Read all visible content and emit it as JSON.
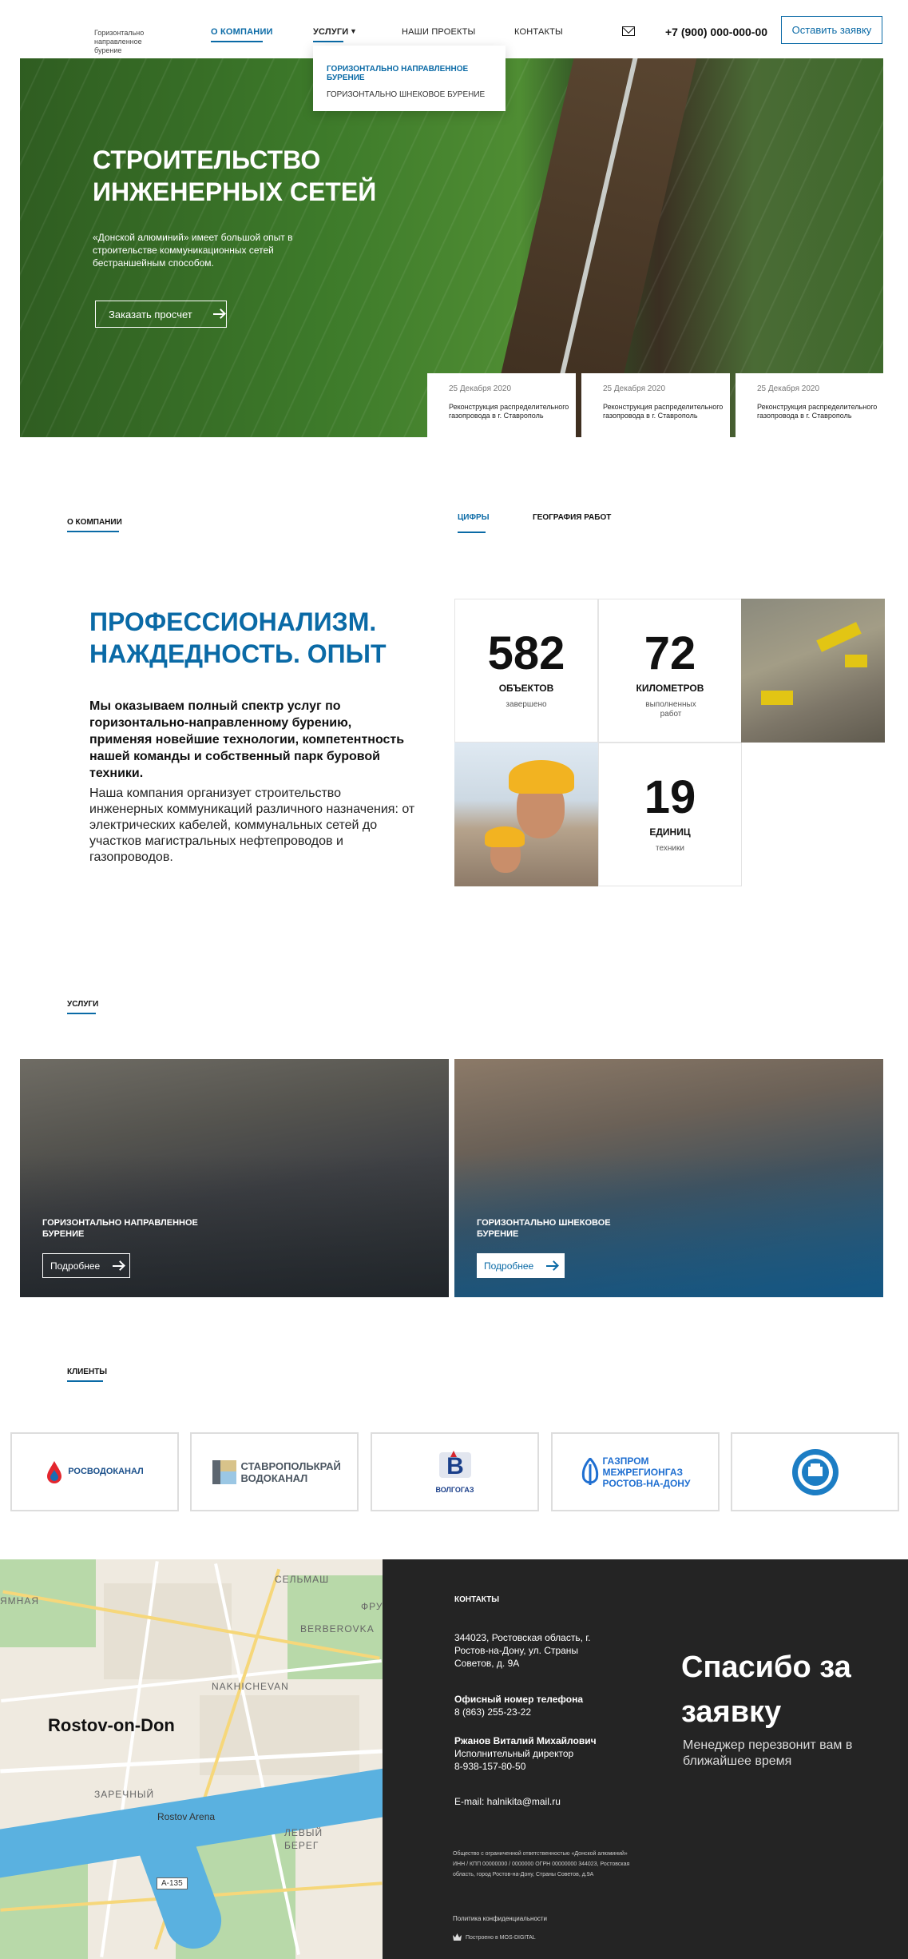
{
  "header": {
    "logo_text": "Горизонтально направленное бурение",
    "nav": {
      "company": "О компании",
      "services": "Услуги",
      "projects": "Наши проекты",
      "contacts": "Контакты"
    },
    "phone": "+7 (900) 000-000-00",
    "cta": "Оставить заявку"
  },
  "dropdown": {
    "items": [
      "Горизонтально направленное бурение",
      "Горизонтально шнековое бурение"
    ]
  },
  "hero": {
    "title": "Строительство инженерных сетей",
    "text": "«Донской алюминий» имеет большой опыт в строительстве коммуникационных сетей бестраншейным способом.",
    "button": "Заказать просчет",
    "news": [
      {
        "date": "25 Декабря 2020",
        "title": "Реконструкция распределительного газопровода в г. Ставрополь"
      },
      {
        "date": "25 Декабря 2020",
        "title": "Реконструкция распределительного газопровода в г. Ставрополь"
      },
      {
        "date": "25 Декабря 2020",
        "title": "Реконструкция распределительного газопровода в г. Ставрополь"
      }
    ]
  },
  "about": {
    "tag": "О компании",
    "tabs": [
      "Цифры",
      "География работ"
    ],
    "heading": "Профессионализм. Наждедность. Опыт",
    "bold_text": "Мы оказываем полный спектр услуг по горизонтально-направленному бурению, применяя новейшие технологии, компетентность нашей команды и собственный парк буровой техники.",
    "text": "Наша компания организует строительство инженерных коммуникаций различного назначения: от электрических кабелей, коммунальных сетей до участков магистральных нефтепроводов и газопроводов.",
    "stats": [
      {
        "value": "582",
        "unit": "Объектов",
        "desc": "завершено"
      },
      {
        "value": "72",
        "unit": "Километров",
        "desc": "выполненных работ"
      },
      {
        "value": "19",
        "unit": "Единиц",
        "desc": "техники"
      }
    ]
  },
  "services": {
    "tag": "Услуги",
    "cards": [
      {
        "title": "Горизонтально направленное бурение",
        "button": "Подробнее"
      },
      {
        "title": "Горизонтально шнековое бурение",
        "button": "Подробнее"
      }
    ]
  },
  "clients": {
    "tag": "Клиенты",
    "logos": [
      "РОСВОДОКАНАЛ",
      "СТАВРОПОЛЬКРАЙ ВОДОКАНАЛ",
      "ВОЛГОГАЗ",
      "ГАЗПРОМ МЕЖРЕГИОНГАЗ РОСТОВ-НА-ДОНУ",
      "emblem"
    ]
  },
  "map": {
    "city": "Rostov-on-Don",
    "arena": "Rostov Arena",
    "road": "A-135",
    "labels": [
      "ЯМНАЯ",
      "СЕЛЬМАШ",
      "ФРУ",
      "BERBEROVKA",
      "NAKHICHEVAN",
      "ЗАРЕЧНЫЙ",
      "ЛЕВЫЙ",
      "БЕРЕГ"
    ]
  },
  "footer": {
    "contacts_tag": "Контакты",
    "address": "344023, Ростовская область, г. Ростов-на-Дону, ул. Страны Советов, д. 9А",
    "phone_label": "Офисный номер телефона",
    "phone": "8 (863) 255-23-22",
    "person": "Ржанов Виталий Михайлович",
    "role": "Исполнительный директор",
    "mobile": "8-938-157-80-50",
    "email": "E-mail: halnikita@mail.ru",
    "legal": "Общество с ограниченной ответственностью «Донской алюминий» ИНН / КПП 00000000 / 0000000 ОГРН 00000000 344023, Ростовская область, город Ростов-на-Дону, Страны Советов, д.9А",
    "policy": "Политика конфиденциальности",
    "built": "Построено в MOS-DIGITAL",
    "thanks_title": "Спасибо за заявку",
    "thanks_text": "Менеджер перезвонит вам в ближайшее время"
  },
  "colors": {
    "accent": "#0a6aa6",
    "footer_bg": "#242424"
  }
}
